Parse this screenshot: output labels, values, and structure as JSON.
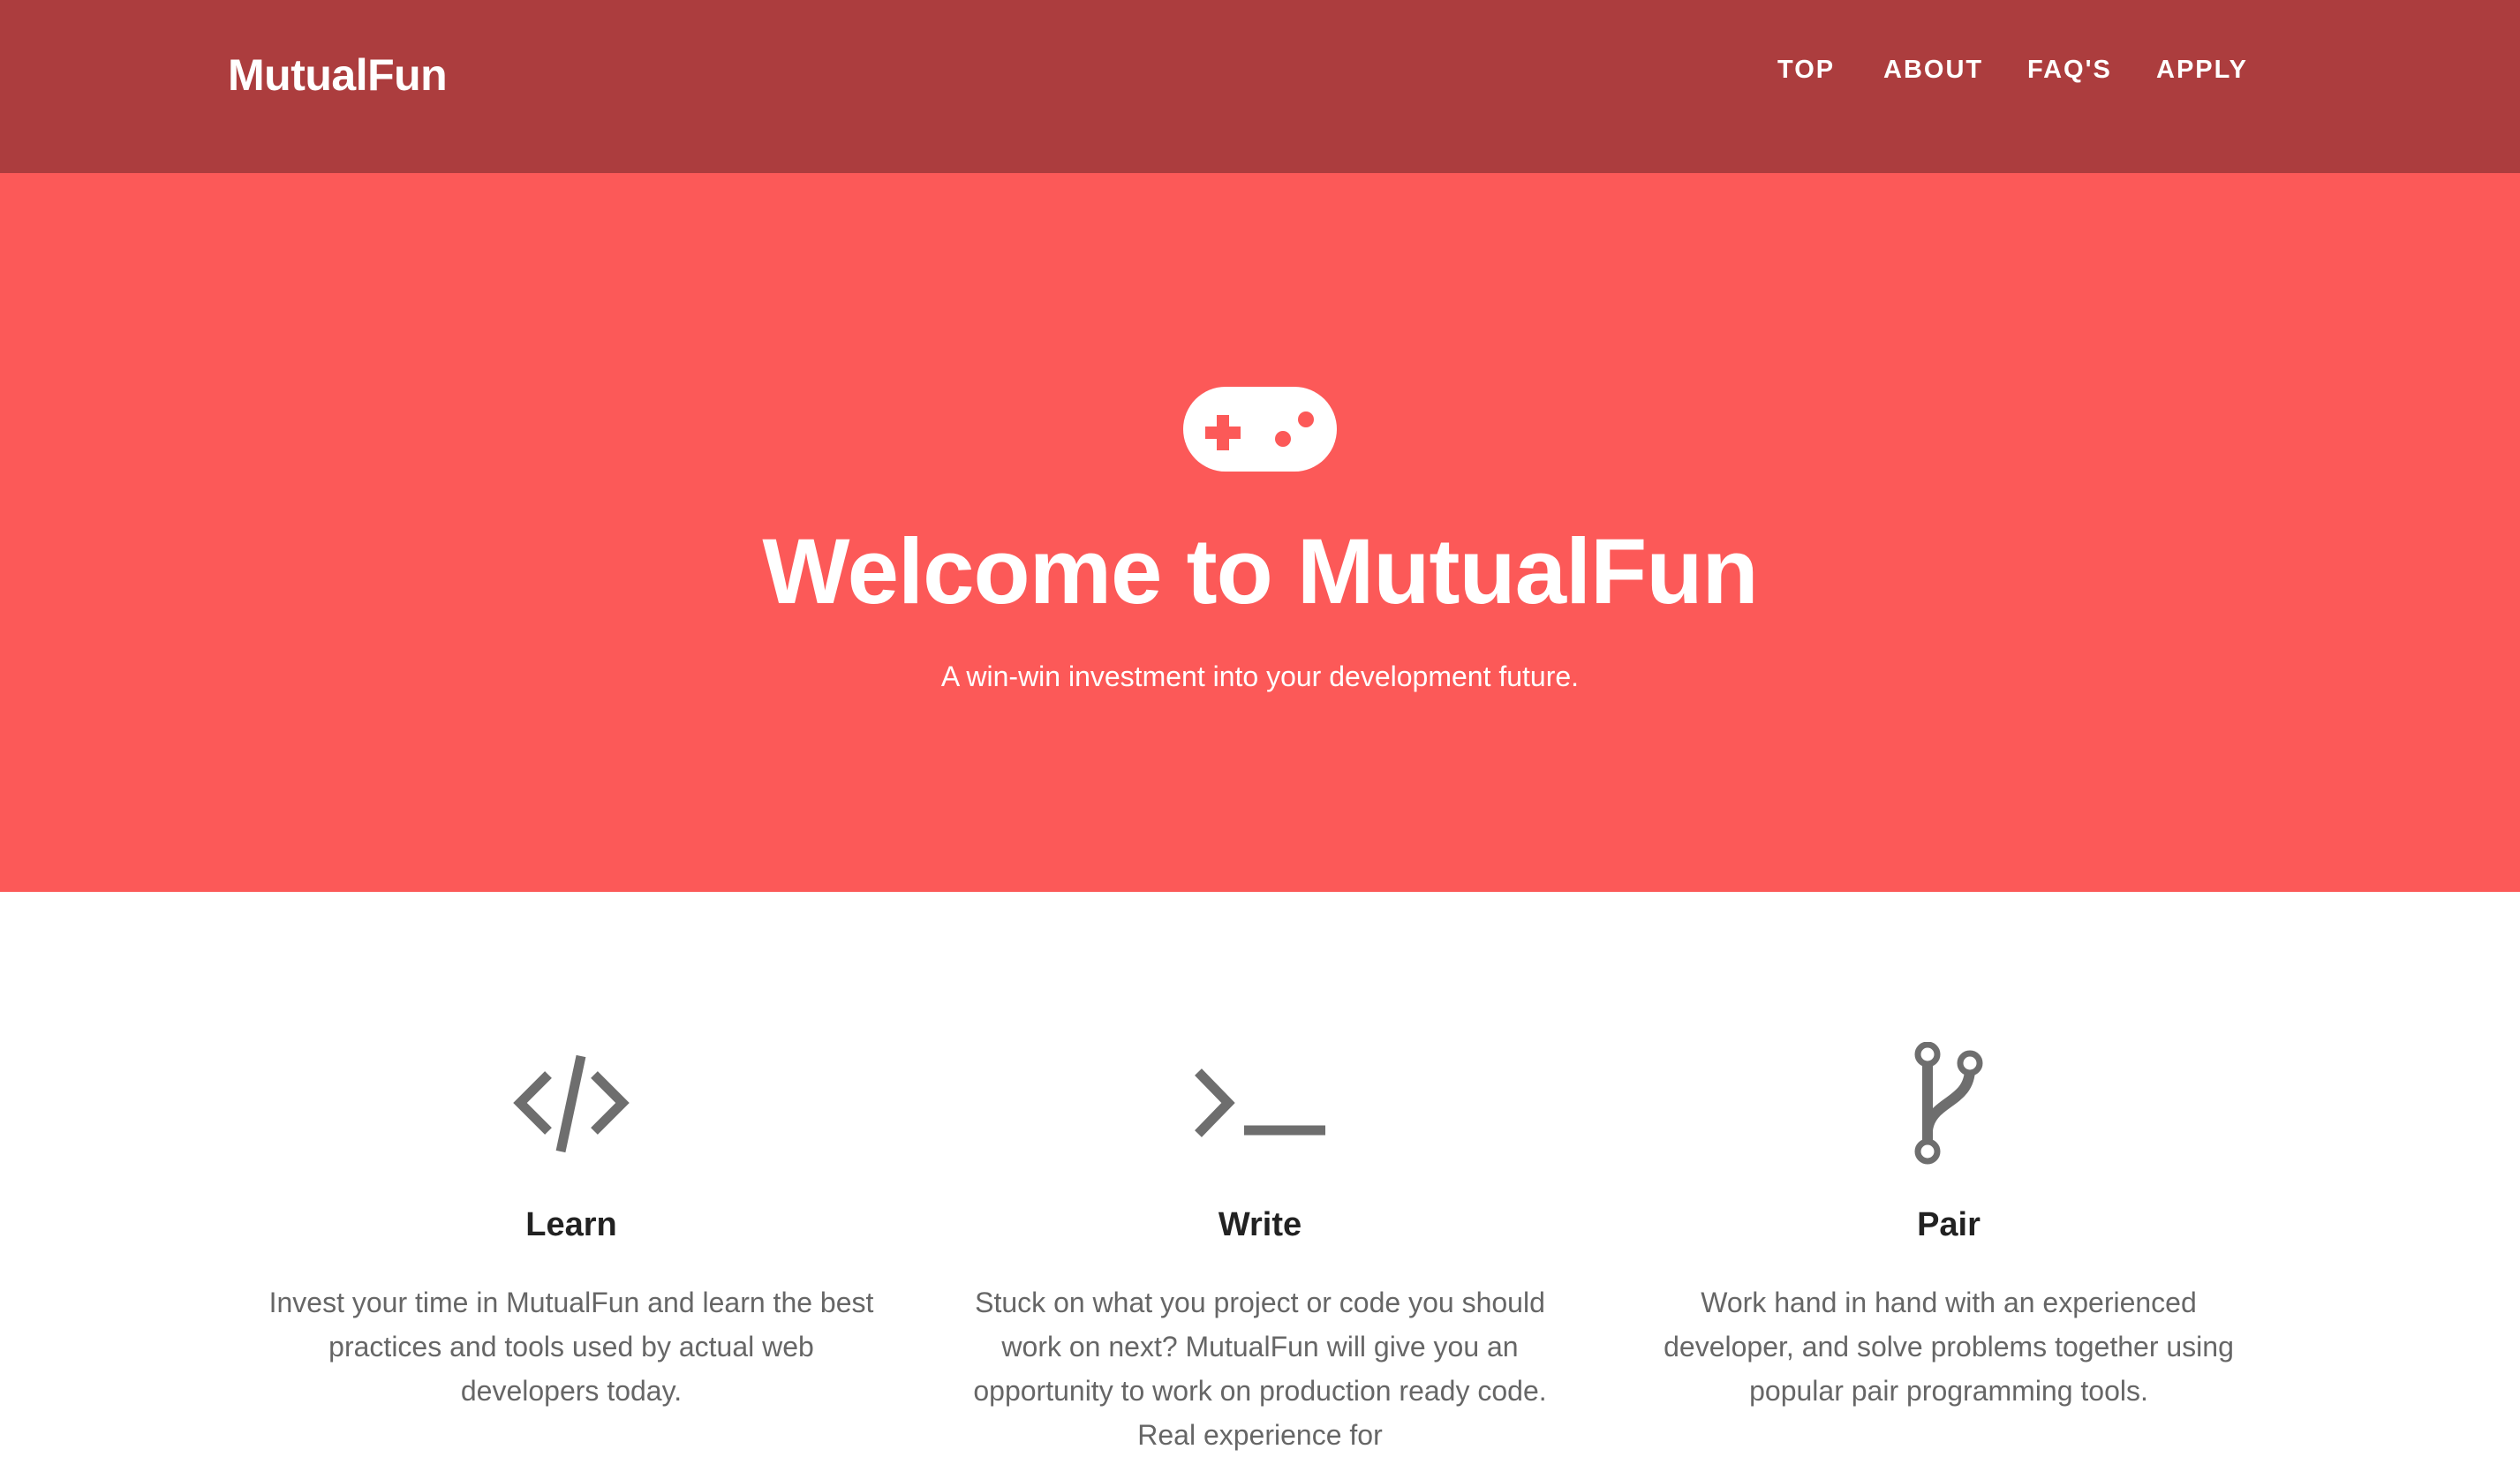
{
  "navbar": {
    "brand": "MutualFun",
    "links": [
      "TOP",
      "ABOUT",
      "FAQ'S",
      "APPLY"
    ]
  },
  "hero": {
    "icon": "gamepad-icon",
    "title": "Welcome to MutualFun",
    "subtitle": "A win-win investment into your development future."
  },
  "features": [
    {
      "icon": "code-icon",
      "title": "Learn",
      "text": "Invest your time in MutualFun and learn the best practices and tools used by actual web developers today."
    },
    {
      "icon": "terminal-icon",
      "title": "Write",
      "text": "Stuck on what you project or code you should work on next? MutualFun will give you an opportunity to work on production ready code. Real experience for"
    },
    {
      "icon": "git-branch-icon",
      "title": "Pair",
      "text": "Work hand in hand with an experienced developer, and solve problems together using popular pair programming tools."
    }
  ],
  "colors": {
    "navbar_bg": "#ac3d3e",
    "hero_bg": "#fc5958",
    "icon_gray": "#6e6e6e",
    "heading": "#222222",
    "body_text": "#666666"
  }
}
